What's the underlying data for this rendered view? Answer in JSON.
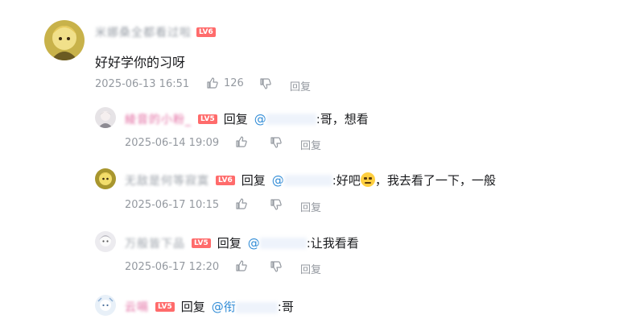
{
  "top_comment": {
    "username": "米娜桑全都看过啦",
    "level": "LV6",
    "text": "好好学你的习呀",
    "date": "2025-06-13 16:51",
    "likes": "126",
    "reply_label": "回复"
  },
  "replies": [
    {
      "username": "綾音的小粉_",
      "level": "LV5",
      "reply_word": "回复",
      "mention": "@",
      "text": ":哥，想看",
      "date": "2025-06-14 19:09",
      "reply_label": "回复"
    },
    {
      "username": "无敌是何等寂寞",
      "level": "LV6",
      "reply_word": "回复",
      "mention": "@",
      "text_before": ":好吧",
      "text_after": "，我去看了一下，一般",
      "date": "2025-06-17 10:15",
      "reply_label": "回复"
    },
    {
      "username": "万般皆下品",
      "level": "LV5",
      "reply_word": "回复",
      "mention": "@",
      "text": ":让我看看",
      "date": "2025-06-17 12:20",
      "reply_label": "回复"
    },
    {
      "username": "云嗝",
      "level": "LV5",
      "reply_word": "回复",
      "mention": "@衔",
      "text": ":哥"
    }
  ],
  "icons": {
    "like": "thumbs-up-icon",
    "dislike": "thumbs-down-icon"
  },
  "colors": {
    "level_badge": "#ff6b6b",
    "mention": "#2f8bd6",
    "meta": "#9499a0"
  }
}
